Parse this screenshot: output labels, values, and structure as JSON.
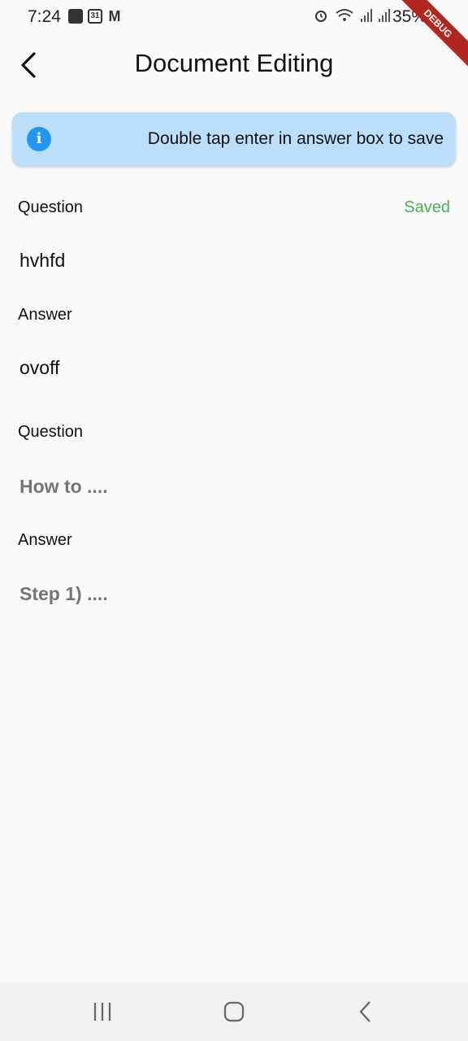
{
  "status_bar": {
    "time": "7:24",
    "calendar_date": "31",
    "mail_glyph": "M",
    "battery": "35%",
    "debug_label": "DEBUG"
  },
  "app_bar": {
    "title": "Document Editing"
  },
  "info_banner": {
    "text": "Double tap enter in answer box to save"
  },
  "entries": [
    {
      "question_label": "Question",
      "status": "Saved",
      "question_value": "hvhfd",
      "answer_label": "Answer",
      "answer_value": "ovoff"
    },
    {
      "question_label": "Question",
      "question_placeholder": "How to ....",
      "answer_label": "Answer",
      "answer_placeholder": "Step 1) ...."
    }
  ],
  "colors": {
    "banner_bg": "#bbdefb",
    "info_icon": "#2196f3",
    "saved": "#4caf50",
    "placeholder": "#757575"
  }
}
